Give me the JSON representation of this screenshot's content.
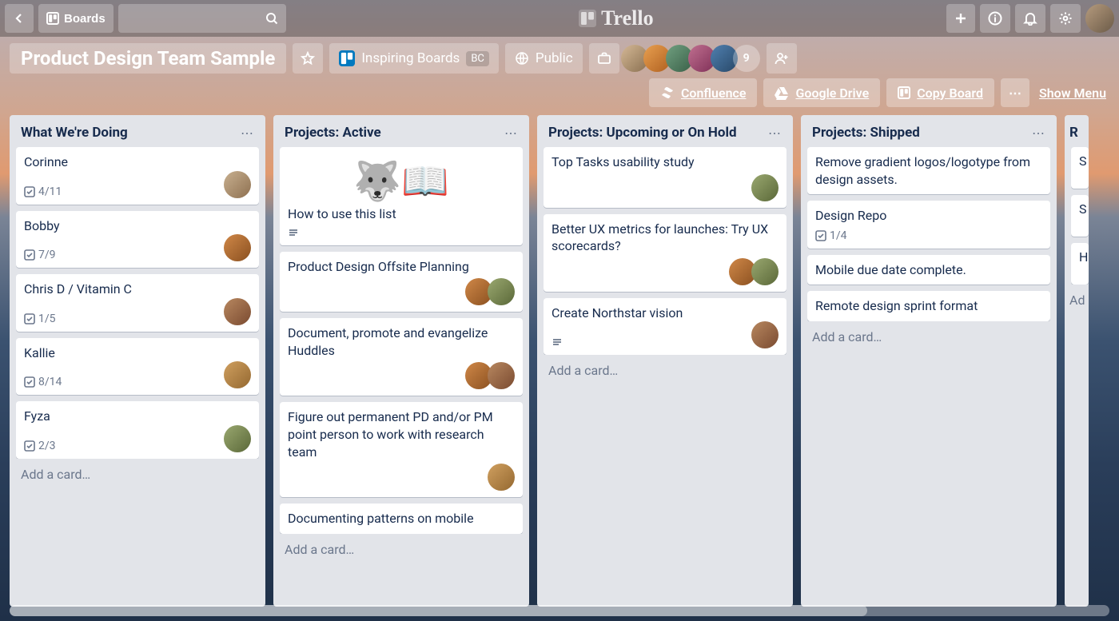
{
  "topbar": {
    "boards_label": "Boards",
    "search_placeholder": ""
  },
  "brand": "Trello",
  "board_header": {
    "title": "Product Design Team Sample",
    "team_chip": {
      "label": "Inspiring Boards",
      "badge": "BC"
    },
    "visibility": "Public",
    "member_overflow_count": "9"
  },
  "action_bar": {
    "confluence": "Confluence",
    "gdrive": "Google Drive",
    "copy": "Copy Board",
    "menu": "Show Menu"
  },
  "lists": {
    "doing": {
      "title": "What We're Doing",
      "cards": [
        {
          "title": "Corinne",
          "checklist": "4/11"
        },
        {
          "title": "Bobby",
          "checklist": "7/9"
        },
        {
          "title": "Chris D / Vitamin C",
          "checklist": "1/5"
        },
        {
          "title": "Kallie",
          "checklist": "8/14"
        },
        {
          "title": "Fyza",
          "checklist": "2/3"
        }
      ],
      "add": "Add a card…"
    },
    "active": {
      "title": "Projects: Active",
      "cards": [
        {
          "title": "How to use this list"
        },
        {
          "title": "Product Design Offsite Planning"
        },
        {
          "title": "Document, promote and evangelize Huddles"
        },
        {
          "title": "Figure out permanent PD and/or PM point person to work with research team"
        },
        {
          "title": "Documenting patterns on mobile"
        }
      ],
      "add": "Add a card…"
    },
    "upcoming": {
      "title": "Projects: Upcoming or On Hold",
      "cards": [
        {
          "title": "Top Tasks usability study"
        },
        {
          "title": "Better UX metrics for launches: Try UX scorecards?"
        },
        {
          "title": "Create Northstar vision"
        }
      ],
      "add": "Add a card…"
    },
    "shipped": {
      "title": "Projects: Shipped",
      "cards": [
        {
          "title": "Remove gradient logos/logotype from design assets."
        },
        {
          "title": "Design Repo",
          "checklist": "1/4"
        },
        {
          "title": "Mobile due date complete."
        },
        {
          "title": "Remote design sprint format"
        }
      ],
      "add": "Add a card…"
    },
    "peek": {
      "title": "R",
      "c1": "S",
      "c2": "S",
      "c3": "H",
      "add": "Ad"
    }
  }
}
